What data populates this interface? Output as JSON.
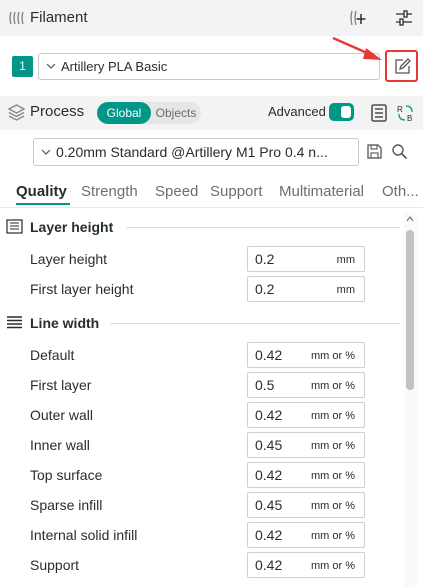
{
  "filament": {
    "title": "Filament",
    "preset_index": "1",
    "preset_name": "Artillery PLA Basic"
  },
  "process": {
    "title": "Process",
    "mode_global": "Global",
    "mode_objects": "Objects",
    "advanced_label": "Advanced",
    "advanced_on": true,
    "preset_name": "0.20mm Standard @Artillery M1 Pro 0.4 n..."
  },
  "tabs": [
    "Quality",
    "Strength",
    "Speed",
    "Support",
    "Multimaterial",
    "Oth..."
  ],
  "active_tab": "Quality",
  "groups": {
    "layer_height": {
      "title": "Layer height",
      "rows": [
        {
          "label": "Layer height",
          "value": "0.2",
          "unit": "mm"
        },
        {
          "label": "First layer height",
          "value": "0.2",
          "unit": "mm"
        }
      ]
    },
    "line_width": {
      "title": "Line width",
      "rows": [
        {
          "label": "Default",
          "value": "0.42",
          "unit": "mm or %"
        },
        {
          "label": "First layer",
          "value": "0.5",
          "unit": "mm or %"
        },
        {
          "label": "Outer wall",
          "value": "0.42",
          "unit": "mm or %"
        },
        {
          "label": "Inner wall",
          "value": "0.45",
          "unit": "mm or %"
        },
        {
          "label": "Top surface",
          "value": "0.42",
          "unit": "mm or %"
        },
        {
          "label": "Sparse infill",
          "value": "0.45",
          "unit": "mm or %"
        },
        {
          "label": "Internal solid infill",
          "value": "0.42",
          "unit": "mm or %"
        },
        {
          "label": "Support",
          "value": "0.42",
          "unit": "mm or %"
        }
      ]
    }
  },
  "icons": {
    "filament": "filament-spool-icon",
    "add_filament": "add-filament-icon",
    "settings": "sliders-icon",
    "edit": "edit-pencil-icon",
    "process": "layers-icon",
    "compare": "compare-list-icon",
    "ab_compare": "ab-compare-icon",
    "save": "save-icon",
    "search": "search-icon"
  },
  "colors": {
    "accent": "#009688",
    "highlight": "#e53935",
    "text": "#262e30"
  }
}
